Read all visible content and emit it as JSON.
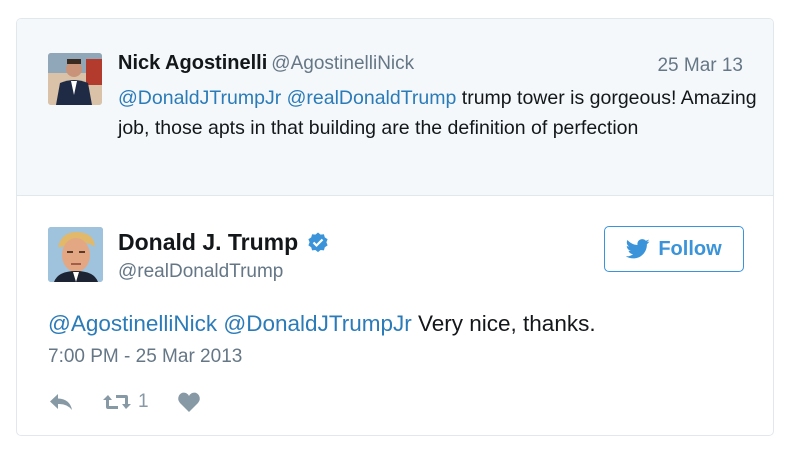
{
  "reply": {
    "name": "Nick Agostinelli",
    "handle": "@AgostinelliNick",
    "date": "25 Mar 13",
    "mention1": "@DonaldJTrumpJr",
    "mention2": "@realDonaldTrump",
    "text": " trump tower is gorgeous! Amazing job, those apts in that building are the definition of perfection"
  },
  "tweet": {
    "name": "Donald J. Trump",
    "handle": "@realDonaldTrump",
    "follow_label": "Follow",
    "mention1": "@AgostinelliNick",
    "mention2": "@DonaldJTrumpJr",
    "text": " Very nice, thanks.",
    "timestamp": "7:00 PM - 25 Mar 2013",
    "retweet_count": "1"
  },
  "icons": {
    "reply": "reply-icon",
    "retweet": "retweet-icon",
    "like": "heart-icon",
    "verified": "verified-badge-icon",
    "bird": "twitter-bird-icon"
  },
  "colors": {
    "link": "#2b7bb9",
    "follow": "#3b94d9",
    "muted": "#657786",
    "action": "#8899a6",
    "reply_bg": "#f5f8fa"
  }
}
